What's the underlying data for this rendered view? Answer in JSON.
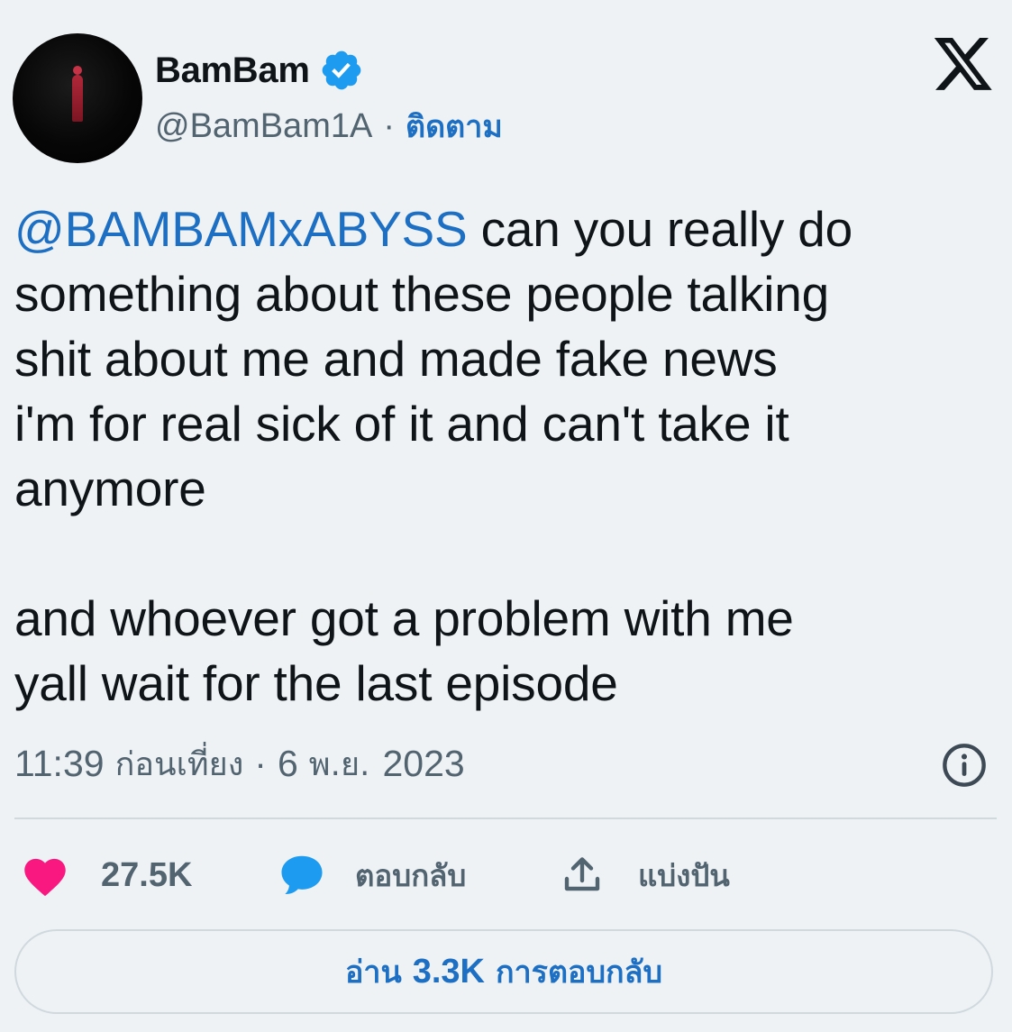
{
  "header": {
    "display_name": "BamBam",
    "handle": "@BamBam1A",
    "separator": "·",
    "follow_label": "ติดตาม",
    "verified_icon": "verified-badge-icon",
    "platform_logo": "x-logo-icon"
  },
  "tweet": {
    "mention": "@BAMBAMxABYSS",
    "line1_rest": " can you really do",
    "line2": "something about these people talking",
    "line3": "shit about me and made fake news",
    "line4": "i'm for real sick of it and can't take it",
    "line5": "anymore",
    "line6": "and whoever got a problem with me",
    "line7": "yall wait for the last episode"
  },
  "meta": {
    "time": "11:39",
    "period": "ก่อนเที่ยง",
    "separator": "·",
    "date_day": "6",
    "date_month": "พ.ย.",
    "date_year": "2023",
    "info_icon": "info-icon"
  },
  "actions": {
    "like_count": "27.5K",
    "reply_label": "ตอบกลับ",
    "share_label": "แบ่งปัน"
  },
  "read_replies": {
    "prefix": "อ่าน",
    "count": "3.3K",
    "suffix": "การตอบกลับ"
  },
  "colors": {
    "background": "#eef2f5",
    "text": "#0f1419",
    "secondary": "#536471",
    "link": "#1d6fc4",
    "verified": "#1d9bf0",
    "like": "#f91880",
    "reply_icon": "#1d9bf0",
    "border": "#cfd9de"
  }
}
